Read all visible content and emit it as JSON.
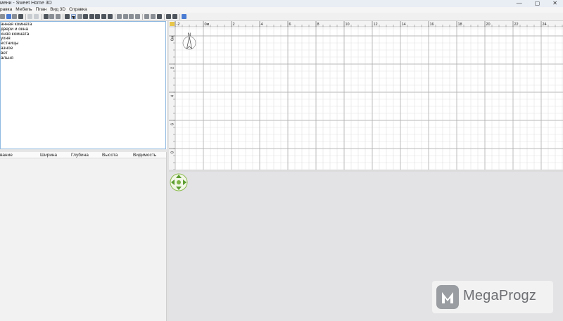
{
  "window": {
    "title": "мени - Sweet Home 3D",
    "controls": {
      "minimize": "—",
      "maximize": "▢",
      "close": "✕"
    }
  },
  "menu": [
    "равка",
    "Мебель",
    "План",
    "Вид 3D",
    "Справка"
  ],
  "catalog": {
    "items": [
      "анная комната",
      "двери и окна",
      "хняя комната",
      "ухня",
      "естницы",
      "азное",
      "вет",
      "альня"
    ]
  },
  "furniture_table": {
    "columns": [
      "вание",
      "Ширина",
      "Глубина",
      "Высота",
      "Видимость"
    ]
  },
  "plan": {
    "ruler_top_labels": [
      "-2",
      "0м",
      "2",
      "4",
      "6",
      "8",
      "10",
      "12",
      "14",
      "16",
      "18",
      "20",
      "22",
      "24"
    ],
    "ruler_left_labels": [
      "0м",
      "2",
      "4",
      "6",
      "8"
    ],
    "compass_letter": "N"
  },
  "watermark": {
    "text": "MegaProgz"
  },
  "icons": {
    "compass": "compass-icon",
    "nav": "3d-navigation-icon",
    "watermark": "megaprogz-logo-icon"
  }
}
